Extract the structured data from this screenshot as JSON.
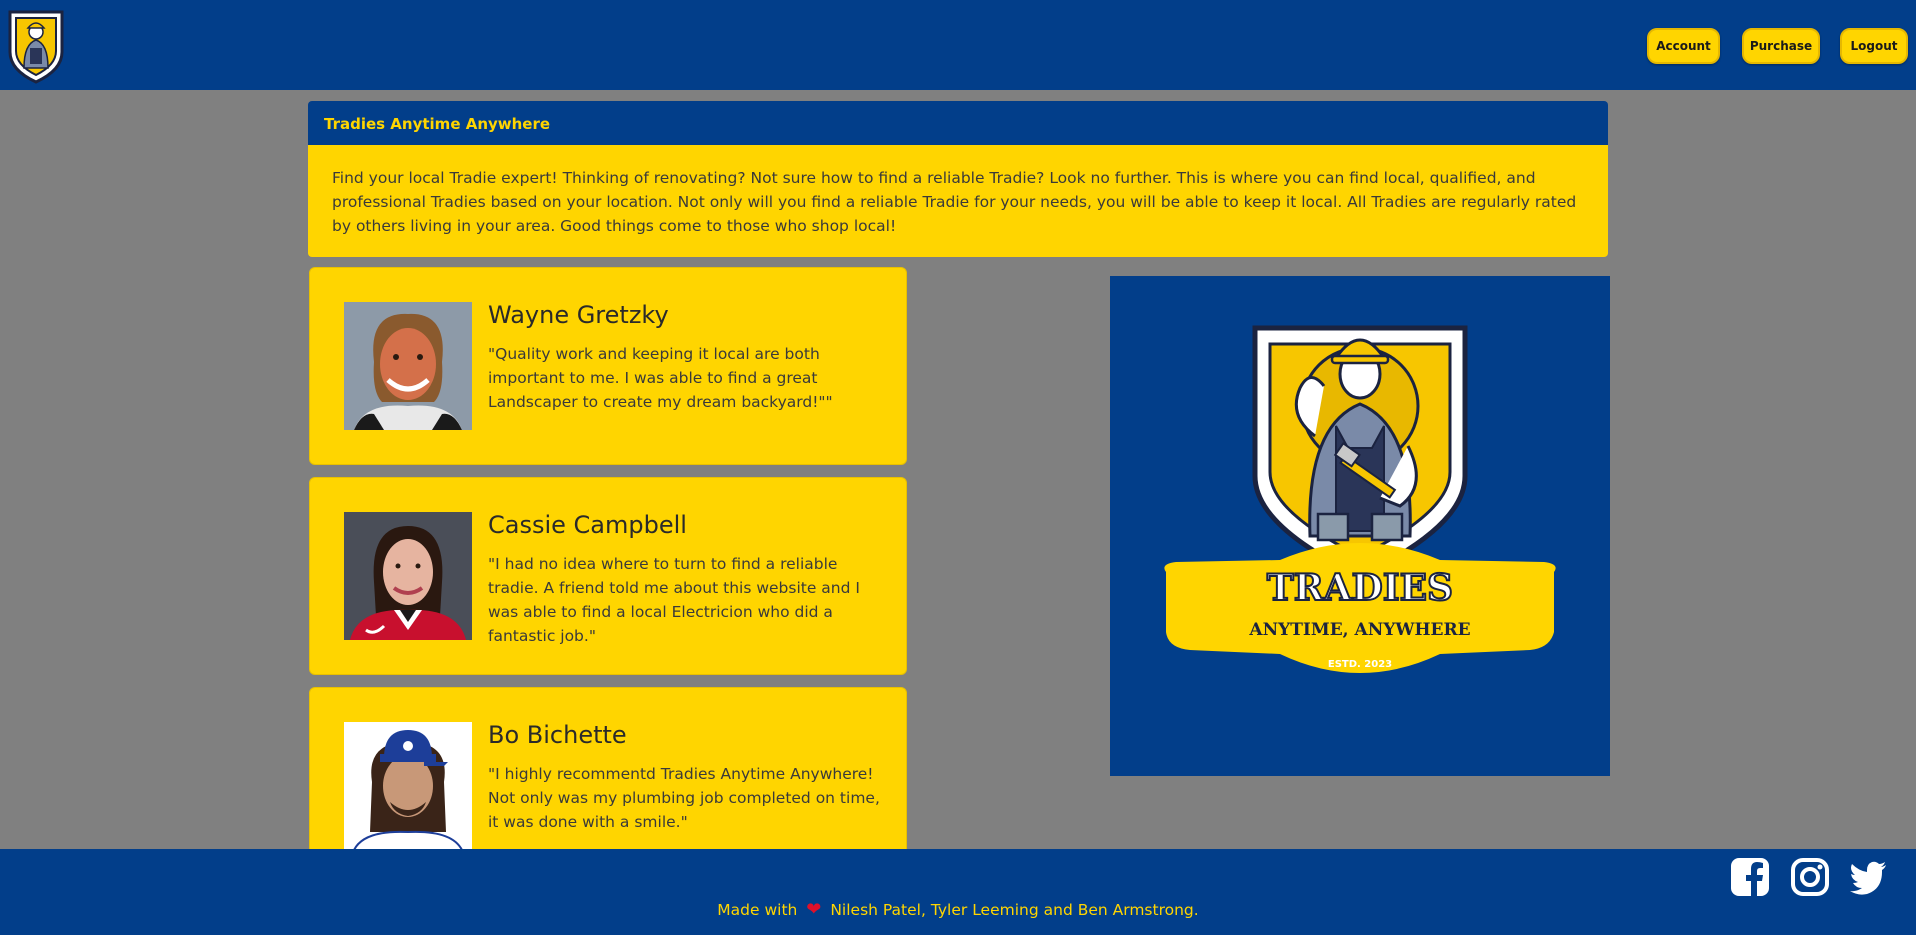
{
  "nav": {
    "buttons": {
      "account": "Account",
      "purchase": "Purchase",
      "logout": "Logout"
    }
  },
  "intro": {
    "title": "Tradies Anytime Anywhere",
    "body": "Find your local Tradie expert! Thinking of renovating? Not sure how to find a reliable Tradie? Look no further. This is where you can find local, qualified, and professional Tradies based on your location. Not only will you find a reliable Tradie for your needs, you will be able to keep it local. All Tradies are regularly rated by others living in your area. Good things come to those who shop local!"
  },
  "testimonials": [
    {
      "name": "Wayne Gretzky",
      "quote": "\"Quality work and keeping it local are both important to me. I was able to find a great Landscaper to create my dream backyard!\"\""
    },
    {
      "name": "Cassie Campbell",
      "quote": "\"I had no idea where to turn to find a reliable tradie. A friend told me about this website and I was able to find a local Electricion who did a fantastic job.\""
    },
    {
      "name": "Bo Bichette",
      "quote": "\"I highly recommentd Tradies Anytime Anywhere! Not only was my plumbing job completed on time, it was done with a smile.\""
    }
  ],
  "brand": {
    "name": "TRADIES",
    "tagline": "ANYTIME, ANYWHERE",
    "established": "ESTD. 2023"
  },
  "footer": {
    "made_with": "Made with",
    "authors": "Nilesh Patel, Tyler Leeming and Ben Armstrong."
  },
  "colors": {
    "navy": "#023e8a",
    "yellow": "#ffd500",
    "background": "#808080"
  }
}
